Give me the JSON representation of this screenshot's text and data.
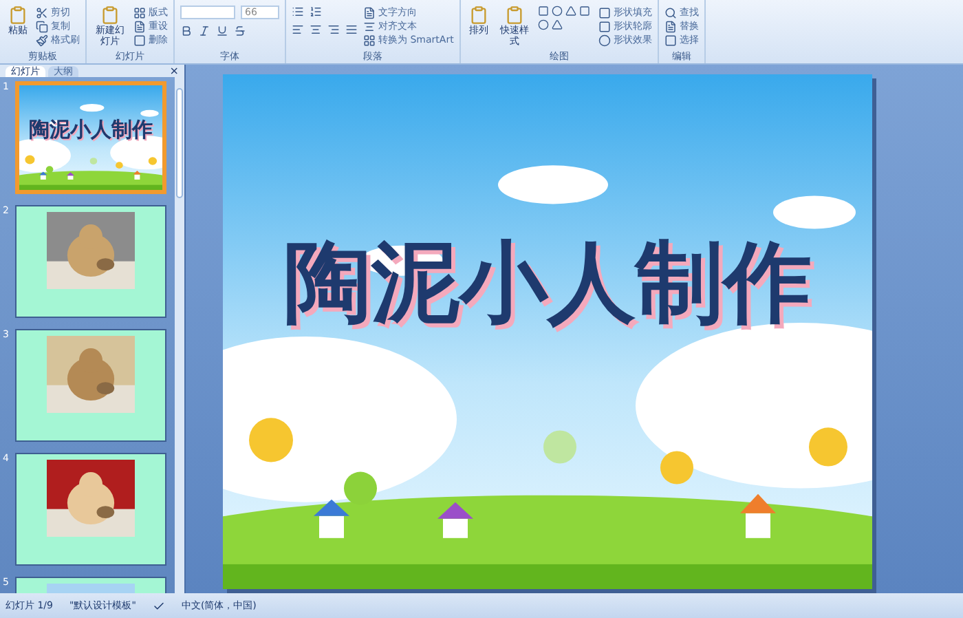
{
  "ribbon": {
    "groups": [
      {
        "label": "剪贴板",
        "kind": "clipboard",
        "items": [
          {
            "kind": "large",
            "label": "粘贴"
          },
          {
            "kind": "small",
            "label": "剪切"
          },
          {
            "kind": "small",
            "label": "复制"
          },
          {
            "kind": "small",
            "label": "格式刷"
          }
        ]
      },
      {
        "label": "幻灯片",
        "kind": "slides",
        "items": [
          {
            "kind": "large",
            "label": "新建幻灯片"
          },
          {
            "kind": "small",
            "label": "版式"
          },
          {
            "kind": "small",
            "label": "重设"
          },
          {
            "kind": "small",
            "label": "删除"
          }
        ]
      },
      {
        "label": "字体",
        "kind": "font",
        "items": [
          {
            "kind": "field",
            "value": "66"
          }
        ]
      },
      {
        "label": "段落",
        "kind": "paragraph",
        "items": [
          {
            "kind": "small",
            "label": "文字方向"
          },
          {
            "kind": "small",
            "label": "对齐文本"
          },
          {
            "kind": "small",
            "label": "转换为 SmartArt"
          }
        ]
      },
      {
        "label": "绘图",
        "kind": "drawing",
        "items": [
          {
            "kind": "large",
            "label": "排列"
          },
          {
            "kind": "large",
            "label": "快速样式"
          },
          {
            "kind": "small",
            "label": "形状填充"
          },
          {
            "kind": "small",
            "label": "形状轮廓"
          },
          {
            "kind": "small",
            "label": "形状效果"
          }
        ]
      },
      {
        "label": "编辑",
        "kind": "editing",
        "items": [
          {
            "kind": "small",
            "label": "查找"
          },
          {
            "kind": "small",
            "label": "替换"
          },
          {
            "kind": "small",
            "label": "选择"
          }
        ]
      }
    ]
  },
  "panel": {
    "tabs": [
      {
        "label": "幻灯片",
        "selected": true
      },
      {
        "label": "大纲",
        "selected": false
      }
    ],
    "close": "×"
  },
  "thumbnails": [
    {
      "number": "1",
      "kind": "title",
      "title": "陶泥小人制作",
      "selected": true
    },
    {
      "number": "2",
      "selected": false
    },
    {
      "number": "3",
      "selected": false
    },
    {
      "number": "4",
      "selected": false
    },
    {
      "number": "5",
      "selected": false
    }
  ],
  "slide": {
    "title": "陶泥小人制作"
  },
  "status_bar": {
    "slide": "幻灯片 1/9",
    "theme": "\"默认设计模板\"",
    "language": "中文(简体，中国)"
  }
}
